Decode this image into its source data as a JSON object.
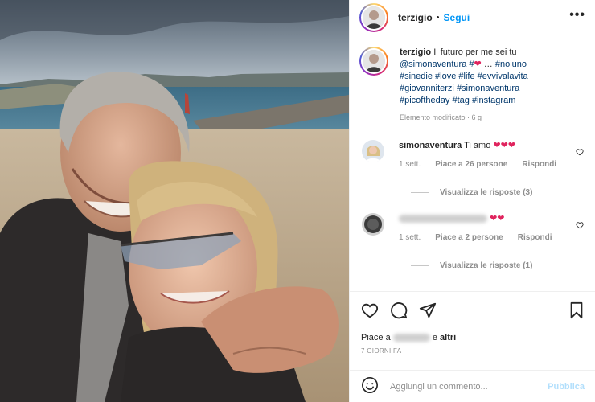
{
  "post": {
    "username": "terzigio",
    "follow_label": "Segui",
    "more_label": "•••"
  },
  "caption": {
    "username": "terzigio",
    "text_1": "Il futuro per me sei tu",
    "mention": "@simonaventura",
    "hash_1": "#",
    "ellipsis": "…",
    "line_tags": [
      "#noiuno",
      "#sinedie",
      "#love",
      "#life",
      "#evvivalavita",
      "#giovanniterzi",
      "#simonaventura",
      "#picoftheday",
      "#tag",
      "#instagram"
    ],
    "meta": "Elemento modificato · 6 g"
  },
  "comments": [
    {
      "username": "simonaventura",
      "text": "Ti amo",
      "hearts": "❤❤❤",
      "time": "1 sett.",
      "likes": "Piace a 26 persone",
      "reply": "Rispondi",
      "view_replies": "Visualizza le risposte (3)"
    },
    {
      "username": "",
      "text": "",
      "hearts": "❤❤",
      "time": "1 sett.",
      "likes": "Piace a 2 persone",
      "reply": "Rispondi",
      "view_replies": "Visualizza le risposte (1)"
    }
  ],
  "likes": {
    "prefix": "Piace a",
    "suffix": "e",
    "others": "altri"
  },
  "time_ago": "7 GIORNI FA",
  "add_comment": {
    "placeholder": "Aggiungi un commento...",
    "publish_label": "Pubblica"
  },
  "colors": {
    "link": "#0095f6",
    "hashtag": "#00376b",
    "heart": "#e0245e",
    "muted": "#8e8e8e"
  },
  "icons": [
    "heart-icon",
    "comment-icon",
    "share-icon",
    "bookmark-icon",
    "emoji-icon",
    "more-icon"
  ]
}
